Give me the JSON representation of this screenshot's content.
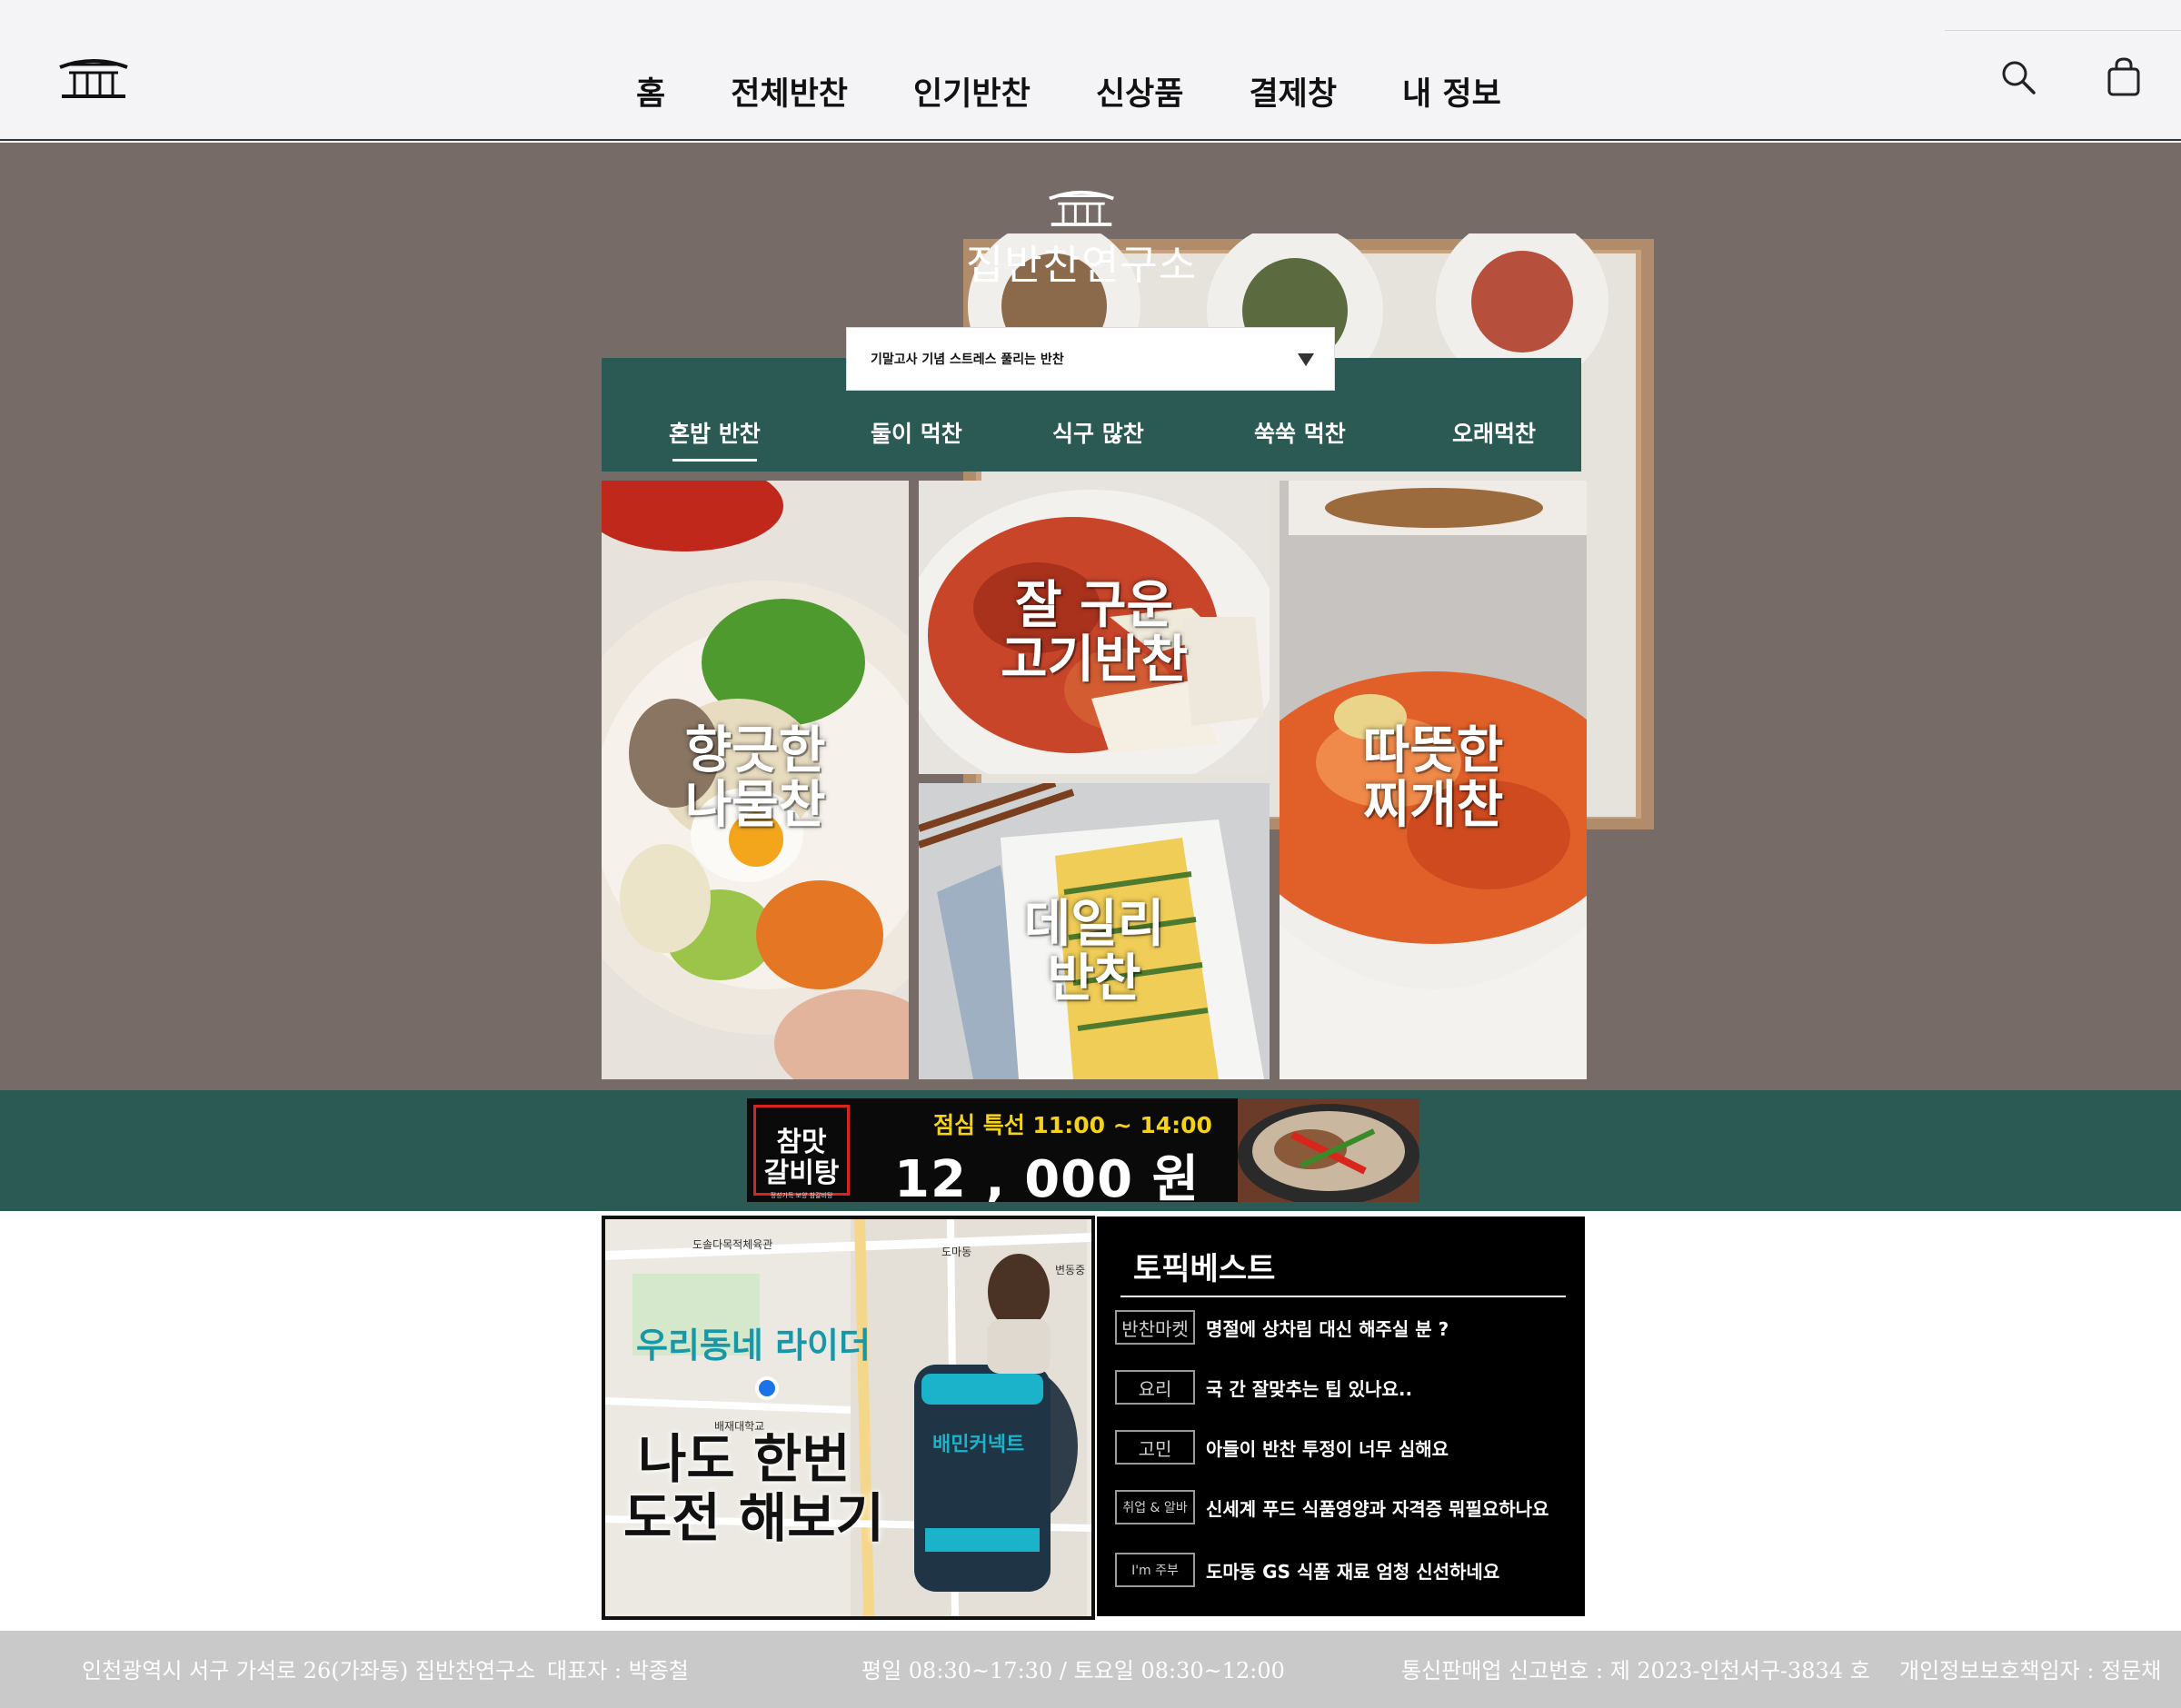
{
  "header": {
    "logo_icon": "hanok-roof-icon",
    "nav": [
      "홈",
      "전체반찬",
      "인기반찬",
      "신상품",
      "결제창",
      "내 정보"
    ],
    "search_icon": "search-icon",
    "cart_icon": "shopping-bag-icon"
  },
  "hero": {
    "brand_name": "집반찬연구소",
    "dropdown_value": "기말고사 기념 스트레스 풀리는 반찬",
    "tabs": [
      "혼밥 반찬",
      "둘이 먹찬",
      "식구 많찬",
      "쑥쑥 먹찬",
      "오래먹찬"
    ],
    "active_tab": "혼밥 반찬",
    "tiles": [
      {
        "line1": "향긋한",
        "line2": "나물찬"
      },
      {
        "line1": "잘 구운",
        "line2": "고기반찬"
      },
      {
        "line1": "데일리",
        "line2": "반찬"
      },
      {
        "line1": "따뜻한",
        "line2": "찌개찬"
      }
    ]
  },
  "promo": {
    "brand_line1": "참맛",
    "brand_line2": "갈비탕",
    "brand_small": "정성가득 보양 참갈비탕",
    "special": "점심 특선 11:00 ~ 14:00",
    "price": "12 , 000 원"
  },
  "rider_ad": {
    "headline": "우리동네 라이더",
    "line1": "나도 한번",
    "line2": "도전 해보기",
    "map_labels": [
      "도솔다목적체육관",
      "배재대학교",
      "변동중",
      "도마동"
    ],
    "bag_label": "배민커넥트"
  },
  "topic_best": {
    "title": "토픽베스트",
    "items": [
      {
        "tag": "반찬마켓",
        "text": "명절에 상차림 대신 해주실 분 ?"
      },
      {
        "tag": "요리",
        "text": "국 간 잘맞추는 팁 있나요.."
      },
      {
        "tag": "고민",
        "text": "아들이 반찬 투정이 너무 심해요"
      },
      {
        "tag": "취업 & 알바",
        "text": "신세계 푸드 식품영양과 자격증 뭐필요하나요"
      },
      {
        "tag": "I'm 주부",
        "text": "도마동 GS 식품 재료 엄청 신선하네요"
      }
    ]
  },
  "footer": {
    "address": "인천광역시 서구 가석로 26(가좌동) 집반찬연구소",
    "ceo": "대표자 : 박종철",
    "hours": "평일 08:30~17:30 / 토요일 08:30~12:00",
    "license": "통신판매업 신고번호 : 제 2023-인천서구-3834 호",
    "privacy": "개인정보보호책임자 : 정문채"
  },
  "colors": {
    "hero_bg": "#766b66",
    "accent_green": "#2b5a54",
    "promo_yellow": "#f4d21c",
    "rider_teal": "#1897a8"
  }
}
